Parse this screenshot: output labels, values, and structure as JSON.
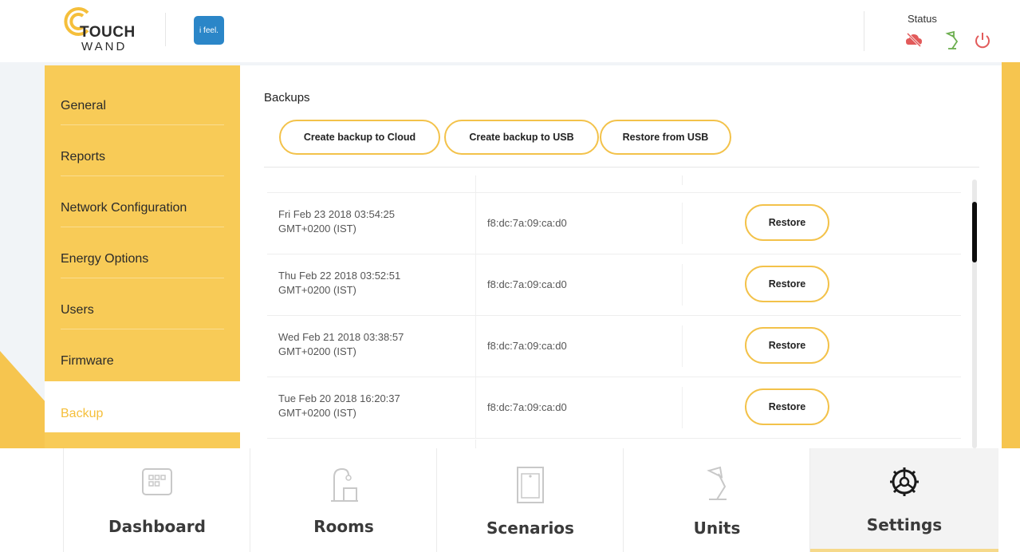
{
  "header": {
    "logo_line1": "TOUCH",
    "logo_line2": "WAND",
    "partner_logo": "i feel.",
    "status_label": "Status",
    "status_icons": [
      "cloud-disconnected-icon",
      "lamp-icon",
      "power-icon"
    ]
  },
  "sidebar": {
    "items": [
      {
        "label": "General"
      },
      {
        "label": "Reports"
      },
      {
        "label": "Network Configuration"
      },
      {
        "label": "Energy Options"
      },
      {
        "label": "Users"
      },
      {
        "label": "Firmware"
      },
      {
        "label": "Backup"
      }
    ],
    "active": "Backup"
  },
  "main": {
    "title": "Backups",
    "buttons": {
      "cloud": "Create backup to Cloud",
      "usb": "Create backup to USB",
      "restore_usb": "Restore from USB"
    },
    "backups": [
      {
        "date_line1": "Fri Feb 23 2018 03:54:25",
        "date_line2": "GMT+0200 (IST)",
        "mac": "f8:dc:7a:09:ca:d0",
        "action": "Restore"
      },
      {
        "date_line1": "Thu Feb 22 2018 03:52:51",
        "date_line2": "GMT+0200 (IST)",
        "mac": "f8:dc:7a:09:ca:d0",
        "action": "Restore"
      },
      {
        "date_line1": "Wed Feb 21 2018 03:38:57",
        "date_line2": "GMT+0200 (IST)",
        "mac": "f8:dc:7a:09:ca:d0",
        "action": "Restore"
      },
      {
        "date_line1": "Tue Feb 20 2018 16:20:37",
        "date_line2": "GMT+0200 (IST)",
        "mac": "f8:dc:7a:09:ca:d0",
        "action": "Restore"
      }
    ]
  },
  "bottom_nav": {
    "items": [
      {
        "label": "Dashboard",
        "icon": "dashboard-icon"
      },
      {
        "label": "Rooms",
        "icon": "rooms-icon"
      },
      {
        "label": "Scenarios",
        "icon": "scenarios-icon"
      },
      {
        "label": "Units",
        "icon": "units-icon"
      },
      {
        "label": "Settings",
        "icon": "settings-icon"
      }
    ],
    "active": "Settings"
  },
  "colors": {
    "accent_yellow": "#f8cb57",
    "button_border": "#f3c24a",
    "active_text": "#f5bf3b",
    "status_red": "#e25a5a",
    "status_green": "#6cae4f"
  }
}
